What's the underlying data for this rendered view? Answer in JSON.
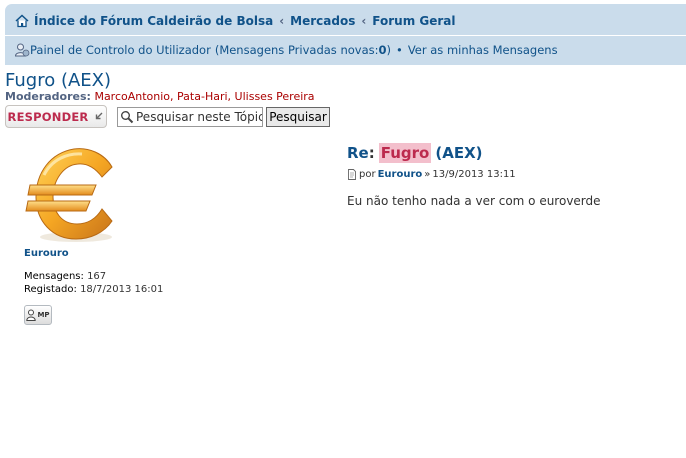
{
  "nav": {
    "breadcrumb": [
      "Índice do Fórum Caldeirão de Bolsa",
      "Mercados",
      "Forum Geral"
    ],
    "ucp_label": "Painel de Controlo do Utilizador",
    "pm_text_before": "(Mensagens Privadas novas: ",
    "pm_count": "0",
    "pm_text_after": ")",
    "bullet": "•",
    "view_messages": "Ver as minhas Mensagens"
  },
  "topic": {
    "title": "Fugro (AEX)",
    "moderators_label": "Moderadores:",
    "moderators": [
      "MarcoAntonio",
      "Pata-Hari",
      "Ulisses Pereira"
    ]
  },
  "actions": {
    "reply_label": "RESPONDER",
    "search_placeholder": "Pesquisar neste Tópico...",
    "search_value": "Pesquisar neste Tópico...",
    "search_button": "Pesquisar"
  },
  "post": {
    "author": "Eurouro",
    "posts_label": "Mensagens:",
    "posts_value": "167",
    "registered_label": "Registado:",
    "registered_value": "18/7/2013 16:01",
    "pm_button_label": "MP",
    "subject_prefix": "Re",
    "subject_colon": ":",
    "subject_highlight": "Fugro",
    "subject_rest": "(AEX)",
    "by_label": "por",
    "date_arrow": "»",
    "date": "13/9/2013 13:11",
    "content": "Eu não tenho nada a ver com o euroverde"
  },
  "colors": {
    "navbar_bg": "#cadceb",
    "link": "#105289",
    "reply_red": "#bc2a4d",
    "highlight_bg": "#f3bfcc",
    "moderator_red": "#aa0000",
    "euro_gold": "#f5a623"
  },
  "icons": {
    "home": "home-icon",
    "ucp": "user-control-panel-icon",
    "reply": "reply-arrow-icon",
    "search": "magnifier-icon",
    "post": "post-file-icon",
    "pm": "user-pm-icon"
  }
}
